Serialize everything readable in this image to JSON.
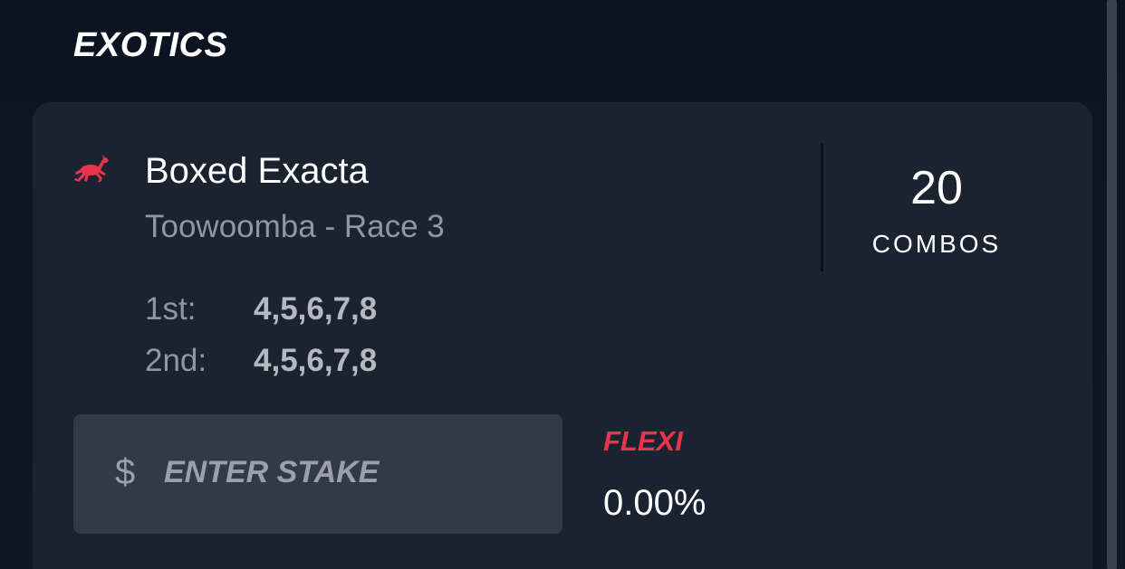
{
  "section": {
    "title": "EXOTICS"
  },
  "bet": {
    "icon": "horse-racing-icon",
    "type": "Boxed Exacta",
    "race": "Toowoomba - Race 3",
    "combos_count": "20",
    "combos_label": "COMBOS",
    "selections": [
      {
        "label": "1st:",
        "value": "4,5,6,7,8"
      },
      {
        "label": "2nd:",
        "value": "4,5,6,7,8"
      }
    ]
  },
  "stake": {
    "currency_symbol": "$",
    "placeholder": "ENTER STAKE",
    "value": ""
  },
  "flexi": {
    "label": "FLEXI",
    "value": "0.00%"
  },
  "colors": {
    "background": "#0d1624",
    "card": "#1b2331",
    "accent": "#e8354b",
    "input": "#323a47"
  }
}
